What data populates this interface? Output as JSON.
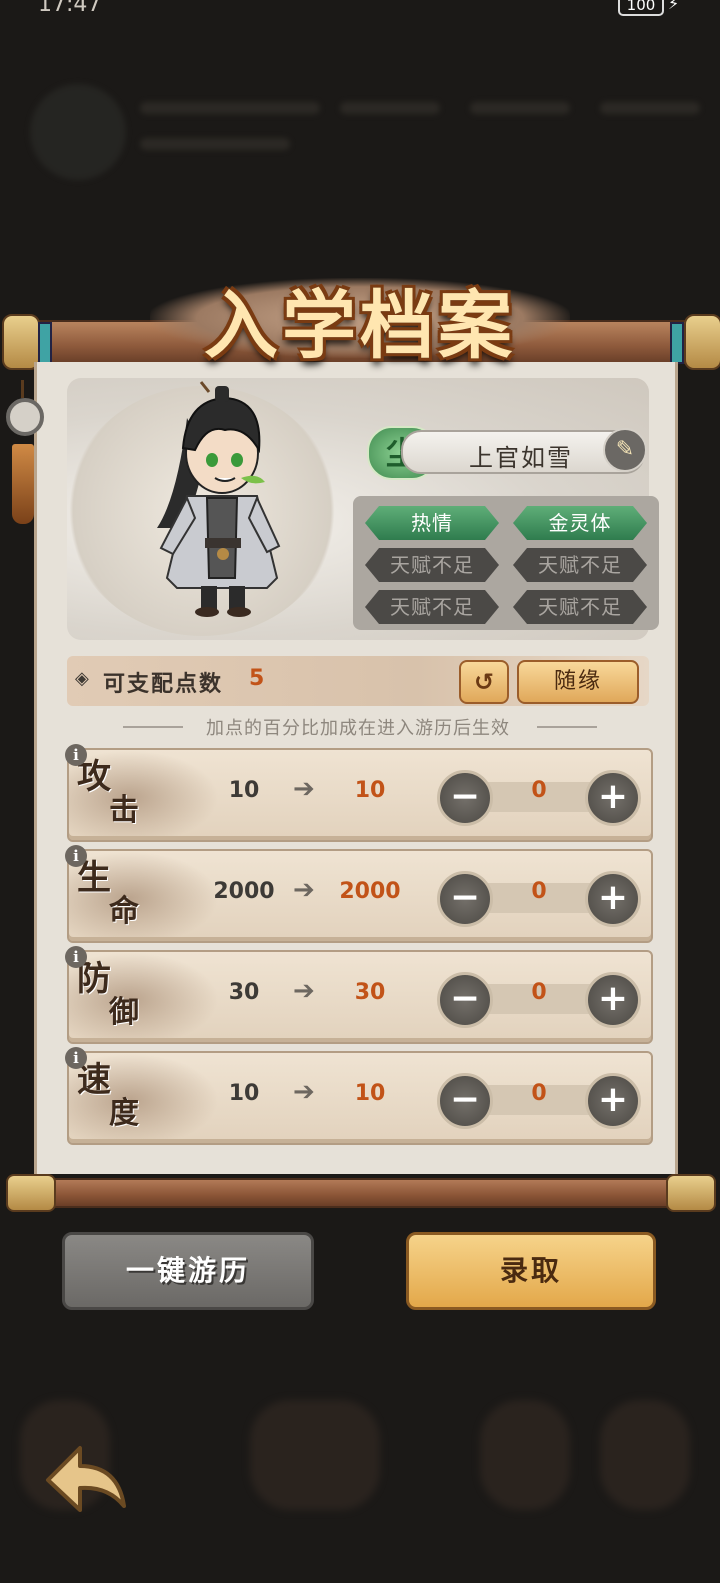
{
  "status": {
    "time": "17:47",
    "battery": "100"
  },
  "title": "入学档案",
  "character": {
    "realm_badge": "尘",
    "name": "上官如雪"
  },
  "talents": [
    {
      "label": "热情",
      "state": "active"
    },
    {
      "label": "金灵体",
      "state": "active"
    },
    {
      "label": "天赋不足",
      "state": "empty"
    },
    {
      "label": "天赋不足",
      "state": "empty"
    },
    {
      "label": "天赋不足",
      "state": "empty"
    },
    {
      "label": "天赋不足",
      "state": "empty"
    }
  ],
  "points": {
    "label": "可支配点数",
    "value": "5",
    "random_label": "随缘"
  },
  "hint": "加点的百分比加成在进入游历后生效",
  "stats": [
    {
      "name1": "攻",
      "name2": "击",
      "base": "10",
      "result": "10",
      "alloc": "0"
    },
    {
      "name1": "生",
      "name2": "命",
      "base": "2000",
      "result": "2000",
      "alloc": "0"
    },
    {
      "name1": "防",
      "name2": "御",
      "base": "30",
      "result": "30",
      "alloc": "0"
    },
    {
      "name1": "速",
      "name2": "度",
      "base": "10",
      "result": "10",
      "alloc": "0"
    }
  ],
  "buttons": {
    "explore": "一键游历",
    "admit": "录取"
  },
  "colors": {
    "accent_orange": "#c25318",
    "talent_green": "#3f8a4f",
    "button_gold": "#e3a84a"
  }
}
